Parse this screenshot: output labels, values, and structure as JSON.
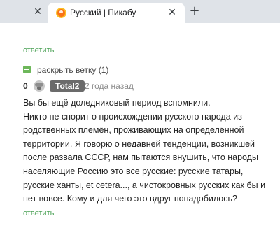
{
  "browser": {
    "tabs": [
      {
        "title": "",
        "active": false
      },
      {
        "title": "Русский | Пикабу",
        "active": true
      }
    ],
    "close_glyph": "✕",
    "new_tab_glyph": "+",
    "favicon": "pikabu-icon"
  },
  "comments": {
    "parent_reply_label": "ответить",
    "expand_label": "раскрыть ветку (1)",
    "comment": {
      "rating": "0",
      "username": "Total2",
      "time": "2 года назад",
      "lines": [
        "Вы бы ещё доледниковый период вспомнили.",
        "Никто не спорит о происхождении русского народа из",
        "родственных племён, проживающих на определённой",
        "территории. Я говорю о недавней тенденции, возникшей",
        "после развала СССР,  нам пытаются внушить, что народы",
        "населяющие Россию это все русские: русские татары,",
        "русские ханты, et cetera..., а чистокровных русских как бы и",
        "нет вовсе. Кому и для чего это вдруг понадобилось?"
      ],
      "reply_label": "ответить"
    }
  },
  "colors": {
    "accent_green": "#4aa155",
    "expand_green": "#6db75a",
    "user_badge": "#6b6b6b",
    "tabbar": "#dfe3e8"
  }
}
